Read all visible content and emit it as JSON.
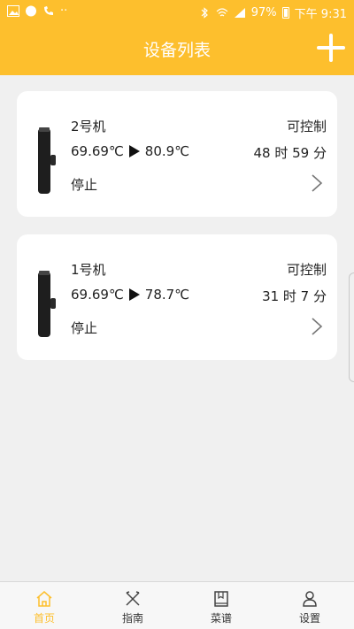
{
  "status_bar": {
    "battery": "97%",
    "time": "下午 9:31"
  },
  "header": {
    "title": "设备列表",
    "add_icon": "plus-icon"
  },
  "devices": [
    {
      "name": "2号机",
      "temp_current": "69.69℃",
      "temp_target": "80.9℃",
      "control": "可控制",
      "time_left": "48 时 59 分",
      "state": "停止"
    },
    {
      "name": "1号机",
      "temp_current": "69.69℃",
      "temp_target": "78.7℃",
      "control": "可控制",
      "time_left": "31 时 7 分",
      "state": "停止"
    }
  ],
  "tabs": [
    {
      "label": "首页",
      "icon": "home-icon",
      "active": true
    },
    {
      "label": "指南",
      "icon": "utensils-icon",
      "active": false
    },
    {
      "label": "菜谱",
      "icon": "book-icon",
      "active": false
    },
    {
      "label": "设置",
      "icon": "user-icon",
      "active": false
    }
  ],
  "colors": {
    "accent": "#fdbf2d",
    "background": "#f0f0f0"
  }
}
